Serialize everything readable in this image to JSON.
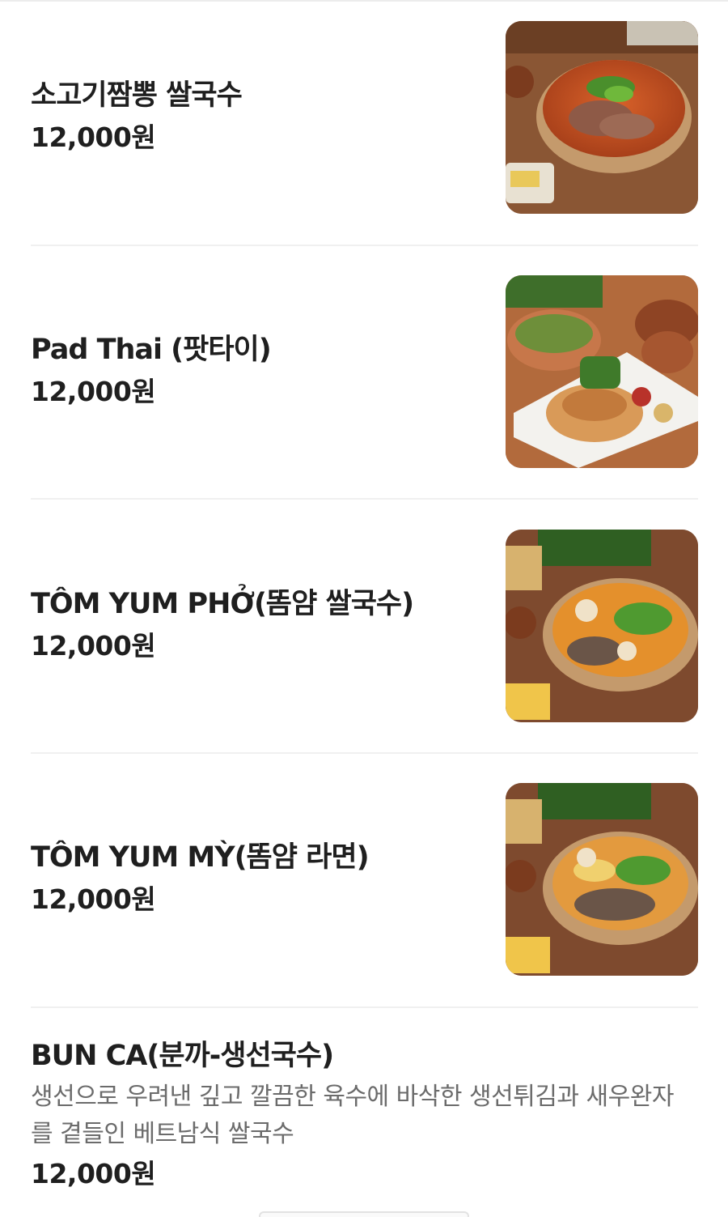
{
  "menu": {
    "items": [
      {
        "name": "소고기짬뽕 쌀국수",
        "price": "12,000원",
        "image": "beef-jjamppong-pho-photo"
      },
      {
        "name": "Pad Thai (팟타이)",
        "price": "12,000원",
        "image": "pad-thai-photo"
      },
      {
        "name": "TÔM YUM PHỞ(똠얌 쌀국수)",
        "price": "12,000원",
        "image": "tom-yum-pho-photo"
      },
      {
        "name": "TÔM YUM MỲ(똠얌 라면)",
        "price": "12,000원",
        "image": "tom-yum-my-photo"
      },
      {
        "name": "BUN CA(분까-생선국수)",
        "description": "생선으로 우려낸 깊고 깔끔한 육수에 바삭한 생선튀김과 새우완자를 곁들인 베트남식 쌀국수",
        "price": "12,000원"
      }
    ]
  },
  "colors": {
    "text": "#1f1f1f",
    "description": "#6b6b6b",
    "divider": "#f0f0f0",
    "background": "#ffffff"
  }
}
